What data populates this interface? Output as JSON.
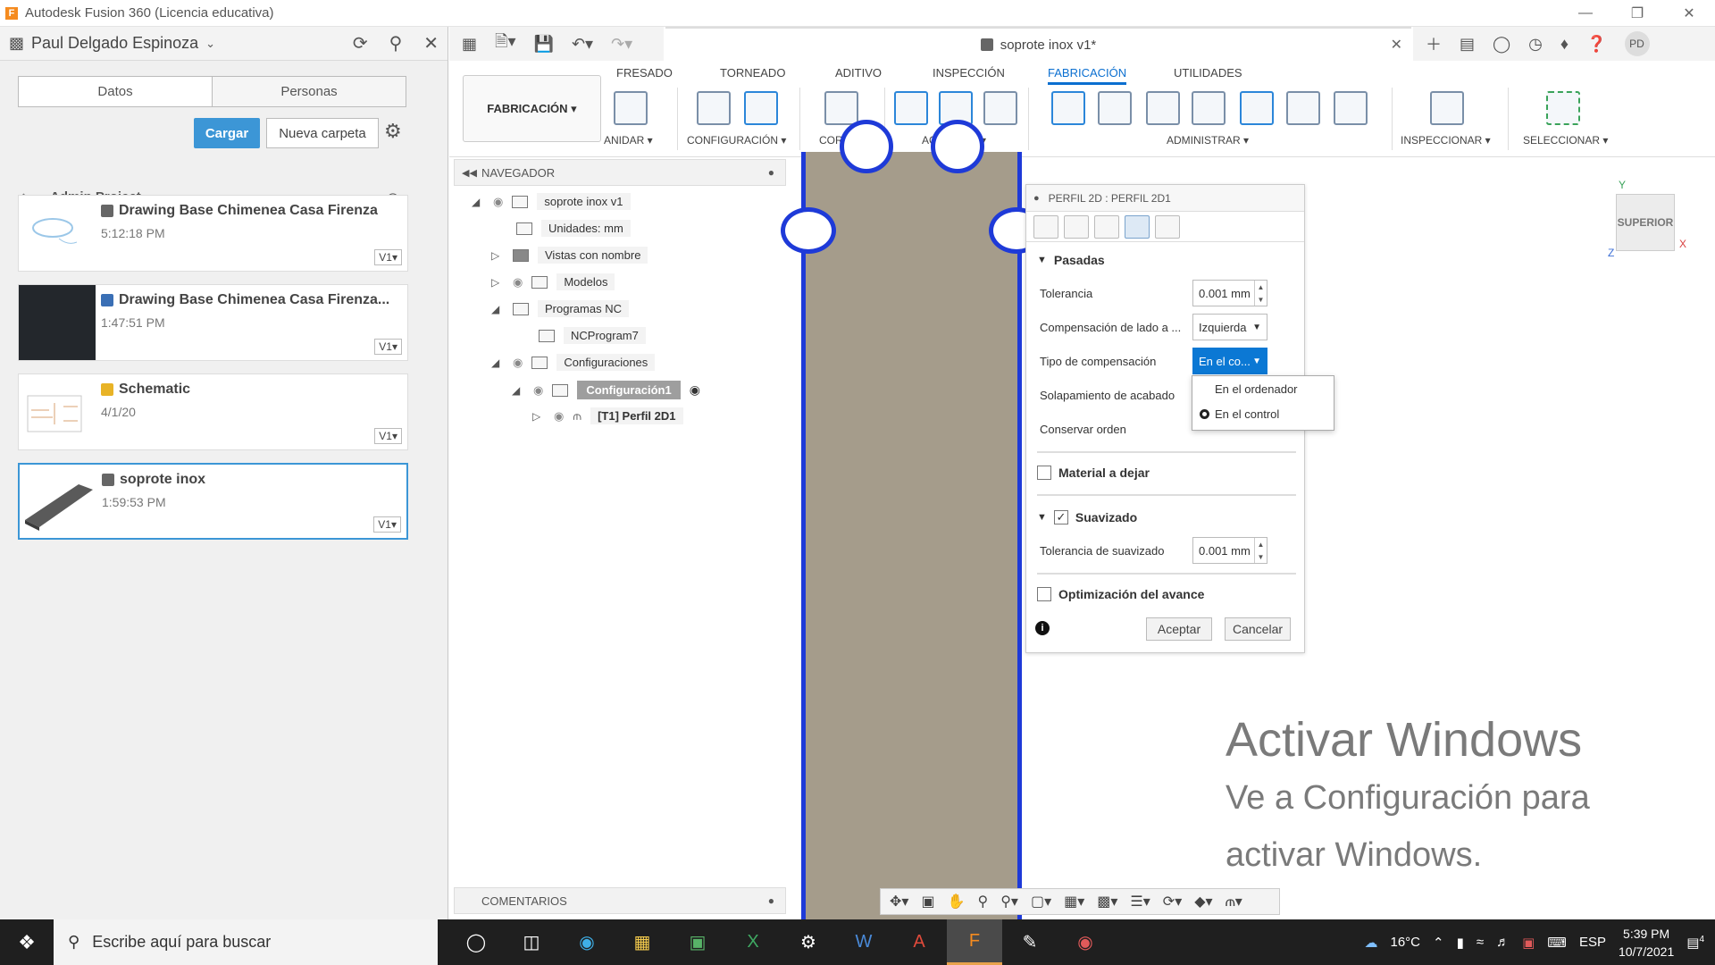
{
  "window": {
    "title": "Autodesk Fusion 360 (Licencia educativa)",
    "logo_letter": "F"
  },
  "data_panel": {
    "user": "Paul Delgado Espinoza",
    "tabs": [
      "Datos",
      "Personas"
    ],
    "upload_label": "Cargar",
    "new_folder_label": "Nueva carpeta",
    "breadcrumb": "Admin Project",
    "files": [
      {
        "name": "Drawing Base Chimenea Casa Firenza",
        "time": "5:12:18 PM",
        "version": "V1▾"
      },
      {
        "name": "Drawing Base Chimenea Casa Firenza...",
        "time": "1:47:51 PM",
        "version": "V1▾"
      },
      {
        "name": "Schematic",
        "time": "4/1/20",
        "version": "V1▾"
      },
      {
        "name": "soprote inox",
        "time": "1:59:53 PM",
        "version": "V1▾"
      }
    ]
  },
  "document_tab": {
    "title": "soprote inox v1*"
  },
  "user_initials": "PD",
  "ribbon": {
    "workspace": "FABRICACIÓN ▾",
    "tabs": [
      "FRESADO",
      "TORNEADO",
      "ADITIVO",
      "INSPECCIÓN",
      "FABRICACIÓN",
      "UTILIDADES"
    ],
    "active_tab": "FABRICACIÓN",
    "groups": [
      "ANIDAR ▾",
      "CONFIGURACIÓN ▾",
      "CORTE ▾",
      "ACCIONES ▾",
      "ADMINISTRAR ▾",
      "INSPECCIONAR ▾",
      "SELECCIONAR ▾"
    ]
  },
  "browser": {
    "title": "NAVEGADOR",
    "tree": [
      "soprote inox v1",
      "Unidades: mm",
      "Vistas con nombre",
      "Modelos",
      "Programas NC",
      "NCProgram7",
      "Configuraciones",
      "Configuración1",
      "[T1] Perfil 2D1"
    ],
    "comments": "COMENTARIOS"
  },
  "dialog": {
    "title": "PERFIL 2D : PERFIL 2D1",
    "sections": {
      "passes": "Pasadas",
      "stock": "Material a dejar",
      "smoothing": "Suavizado",
      "feed_opt": "Optimización del avance"
    },
    "rows": {
      "tolerance_label": "Tolerancia",
      "tolerance_value": "0.001 mm",
      "side_comp_label": "Compensación de lado a ...",
      "side_comp_value": "Izquierda",
      "comp_type_label": "Tipo de compensación",
      "comp_type_value": "En el co...",
      "finish_overlap_label": "Solapamiento de acabado",
      "keep_order_label": "Conservar orden",
      "smooth_tol_label": "Tolerancia de suavizado",
      "smooth_tol_value": "0.001 mm"
    },
    "dropdown_options": [
      "En el ordenador",
      "En el control"
    ],
    "selected_option": "En el control",
    "ok_label": "Aceptar",
    "cancel_label": "Cancelar"
  },
  "viewcube": {
    "face": "SUPERIOR",
    "axis_x": "X",
    "axis_y": "Y",
    "axis_z": "Z"
  },
  "watermark": {
    "line1": "Activar Windows",
    "line2": "Ve a Configuración para",
    "line3": "activar Windows."
  },
  "taskbar": {
    "search_placeholder": "Escribe aquí para buscar",
    "temperature": "16°C",
    "language": "ESP",
    "time": "5:39 PM",
    "date": "10/7/2021",
    "notifications": "4"
  },
  "colors": {
    "accent": "#0b78d4",
    "toolpath": "#1e3ad8",
    "stock": "#a59c8b",
    "upload_button": "#3c96d6"
  }
}
